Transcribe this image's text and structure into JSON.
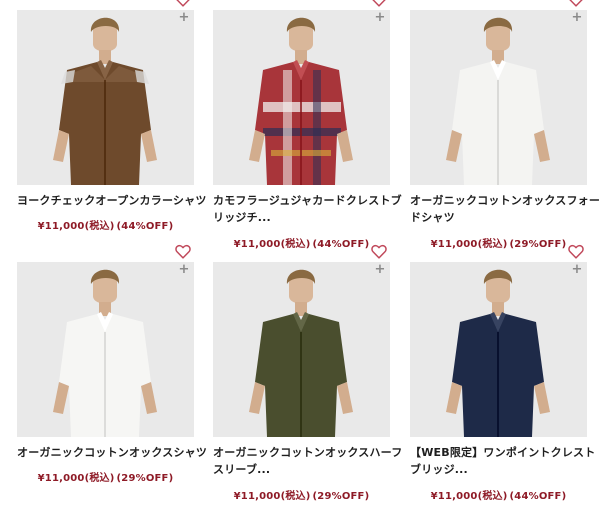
{
  "products": [
    {
      "title_line1": "ヨークチェックオープンカラーシャツ",
      "title_line2": "",
      "price": "¥11,000(税込)",
      "sale": "(44%OFF)",
      "shirt_color": "#6e4a2c",
      "pattern": "yoke"
    },
    {
      "title_line1": "カモフラージュジャカードクレストブ",
      "title_line2": "リッジチ...",
      "price": "¥11,000(税込)",
      "sale": "(44%OFF)",
      "shirt_color": "#a8353a",
      "pattern": "plaid"
    },
    {
      "title_line1": "オーガニックコットンオックスフォー",
      "title_line2": "ドシャツ",
      "price": "¥11,000(税込)",
      "sale": "(29%OFF)",
      "shirt_color": "#f4f4f2",
      "pattern": "plain"
    },
    {
      "title_line1": "オーガニックコットンオックスシャツ",
      "title_line2": "",
      "price": "¥11,000(税込)",
      "sale": "(29%OFF)",
      "shirt_color": "#f6f6f4",
      "pattern": "plain"
    },
    {
      "title_line1": "オーガニックコットンオックスハーフ",
      "title_line2": "スリーブ...",
      "price": "¥11,000(税込)",
      "sale": "(29%OFF)",
      "shirt_color": "#4a4e2e",
      "pattern": "plain"
    },
    {
      "title_line1": "【WEB限定】ワンポイントクレスト",
      "title_line2": "ブリッジ...",
      "price": "¥11,000(税込)",
      "sale": "(44%OFF)",
      "shirt_color": "#1e2a48",
      "pattern": "plain"
    }
  ],
  "icons": {
    "add": "+",
    "favorite": "heart-outline-icon"
  },
  "colors": {
    "price": "#8e1a26",
    "heart": "#c0485a",
    "photo_bg": "#e9e9e9"
  }
}
